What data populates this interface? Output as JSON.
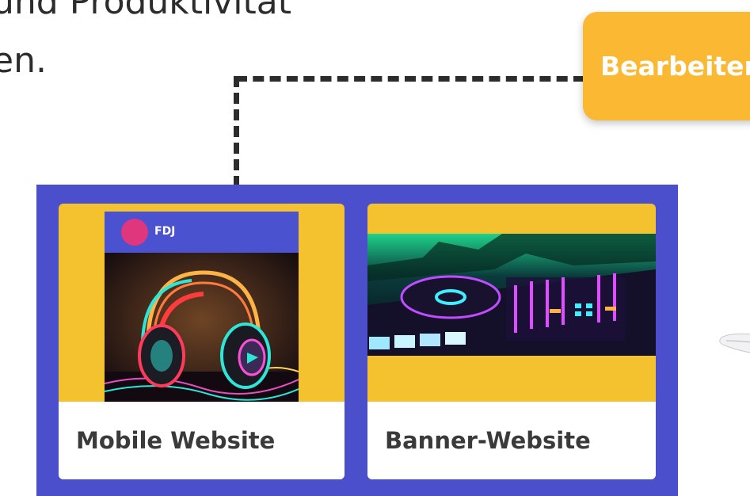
{
  "headline": {
    "line1": "und Produktivität",
    "line2": "en."
  },
  "edit_button": {
    "label": "Bearbeiten"
  },
  "cards": [
    {
      "title": "Mobile Website",
      "brand": "FDJ"
    },
    {
      "title": "Banner-Website"
    }
  ],
  "colors": {
    "panel": "#4b4fcc",
    "card_background": "#f4c22e",
    "edit_button": "#fbb833",
    "avatar": "#e0367e",
    "mock_header": "#4b52cf"
  }
}
